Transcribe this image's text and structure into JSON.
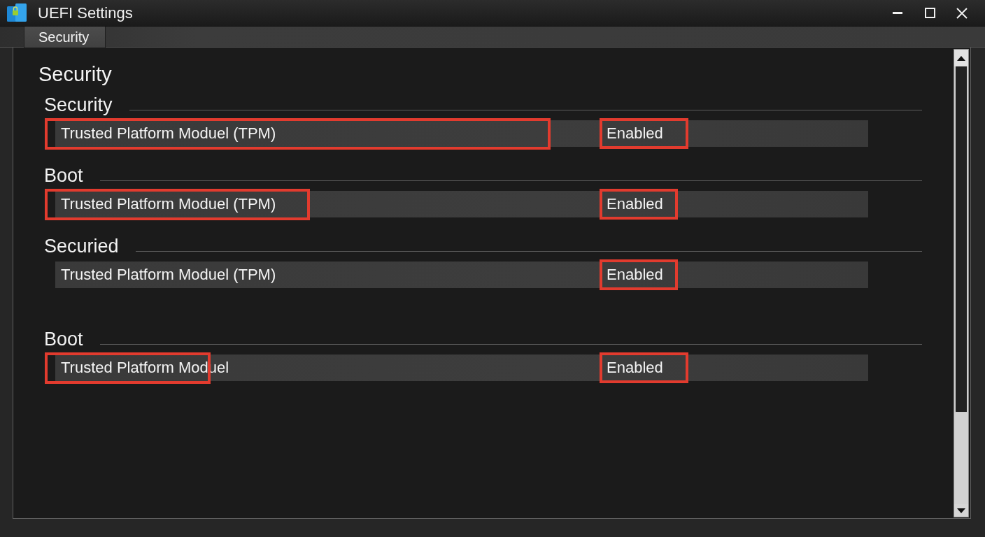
{
  "window": {
    "title": "UEFI Settings"
  },
  "tabs": [
    {
      "label": "Security",
      "selected": true
    }
  ],
  "page_title": "Security",
  "sections": [
    {
      "title": "Security",
      "settings": [
        {
          "label": "Trusted Platform Moduel (TPM)",
          "value": "Enabled",
          "label_highlighted": true,
          "value_highlighted": true
        }
      ]
    },
    {
      "title": "Boot",
      "settings": [
        {
          "label": "Trusted Platform Moduel (TPM)",
          "value": "Enabled",
          "label_highlighted": true,
          "value_highlighted": true
        }
      ]
    },
    {
      "title": "Securied",
      "settings": [
        {
          "label": "Trusted Platform Moduel (TPM)",
          "value": "Enabled",
          "label_highlighted": false,
          "value_highlighted": true
        }
      ]
    },
    {
      "title": "Boot",
      "settings": [
        {
          "label": "Trusted Platform Moduel",
          "value": "Enabled",
          "label_highlighted": true,
          "value_highlighted": true
        }
      ]
    }
  ]
}
